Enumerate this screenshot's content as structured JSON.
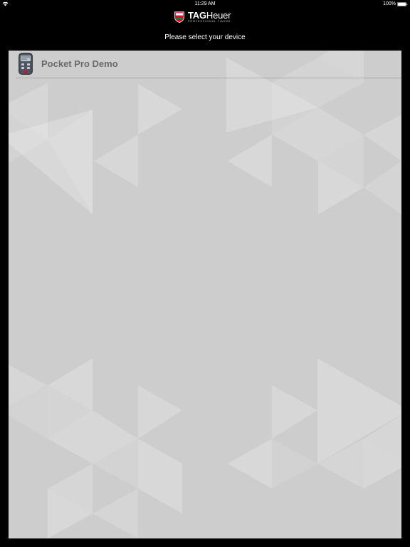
{
  "status_bar": {
    "time": "11:29 AM",
    "battery": "100%",
    "wifi_icon": "wifi-icon",
    "battery_icon": "battery-icon"
  },
  "header": {
    "brand": "TAGHeuer",
    "brand_bold": "TAG",
    "brand_rest": "Heuer",
    "brand_subtitle": "PROFESSIONAL TIMING",
    "emblem_icon": "tag-heuer-emblem-icon",
    "prompt": "Please select your device"
  },
  "devices": [
    {
      "label": "Pocket Pro Demo",
      "icon": "stopwatch-device-icon"
    }
  ],
  "colors": {
    "background": "#000000",
    "panel": "#cdcdcd",
    "device_text": "#6b6b6b",
    "accent_red": "#d0102a",
    "accent_green": "#1f7a3a"
  }
}
